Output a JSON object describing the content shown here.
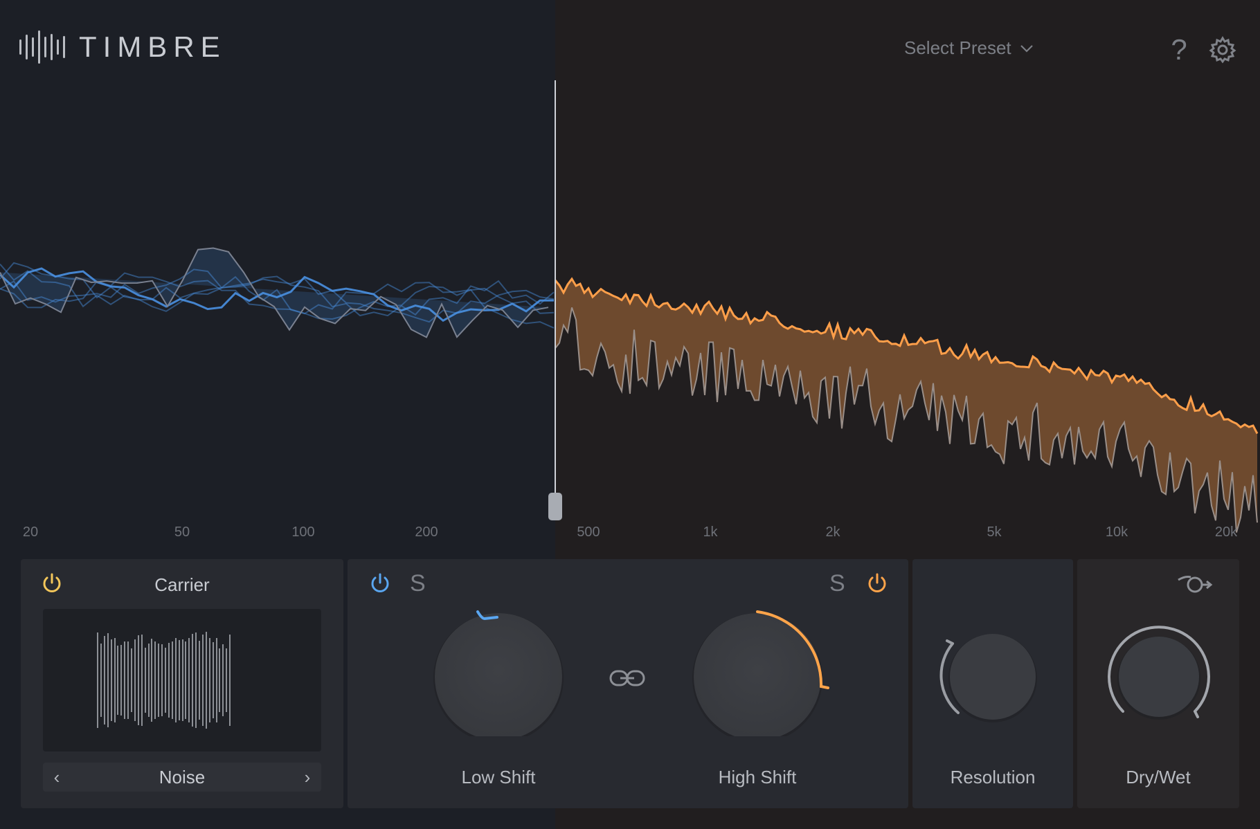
{
  "app": {
    "title": "TIMBRE"
  },
  "header": {
    "preset_label": "Select Preset",
    "help_label": "?",
    "icons": [
      "logo-bars-icon",
      "chevron-down-icon",
      "help-icon",
      "gear-icon"
    ]
  },
  "spectrum": {
    "frequency_labels": [
      "20",
      "50",
      "100",
      "200",
      "500",
      "1k",
      "2k",
      "5k",
      "10k",
      "20k"
    ],
    "low_color": "#4a90e2",
    "high_color": "#ff9f4a"
  },
  "carrier": {
    "title": "Carrier",
    "source": "Noise",
    "prev_label": "‹",
    "next_label": "›",
    "power_color": "#f3c65a"
  },
  "shift": {
    "low": {
      "label": "Low Shift",
      "solo_label": "S",
      "power_color": "#5aa6f0"
    },
    "high": {
      "label": "High Shift",
      "solo_label": "S",
      "power_color": "#ffa44a"
    }
  },
  "resolution": {
    "label": "Resolution"
  },
  "drywet": {
    "label": "Dry/Wet"
  }
}
